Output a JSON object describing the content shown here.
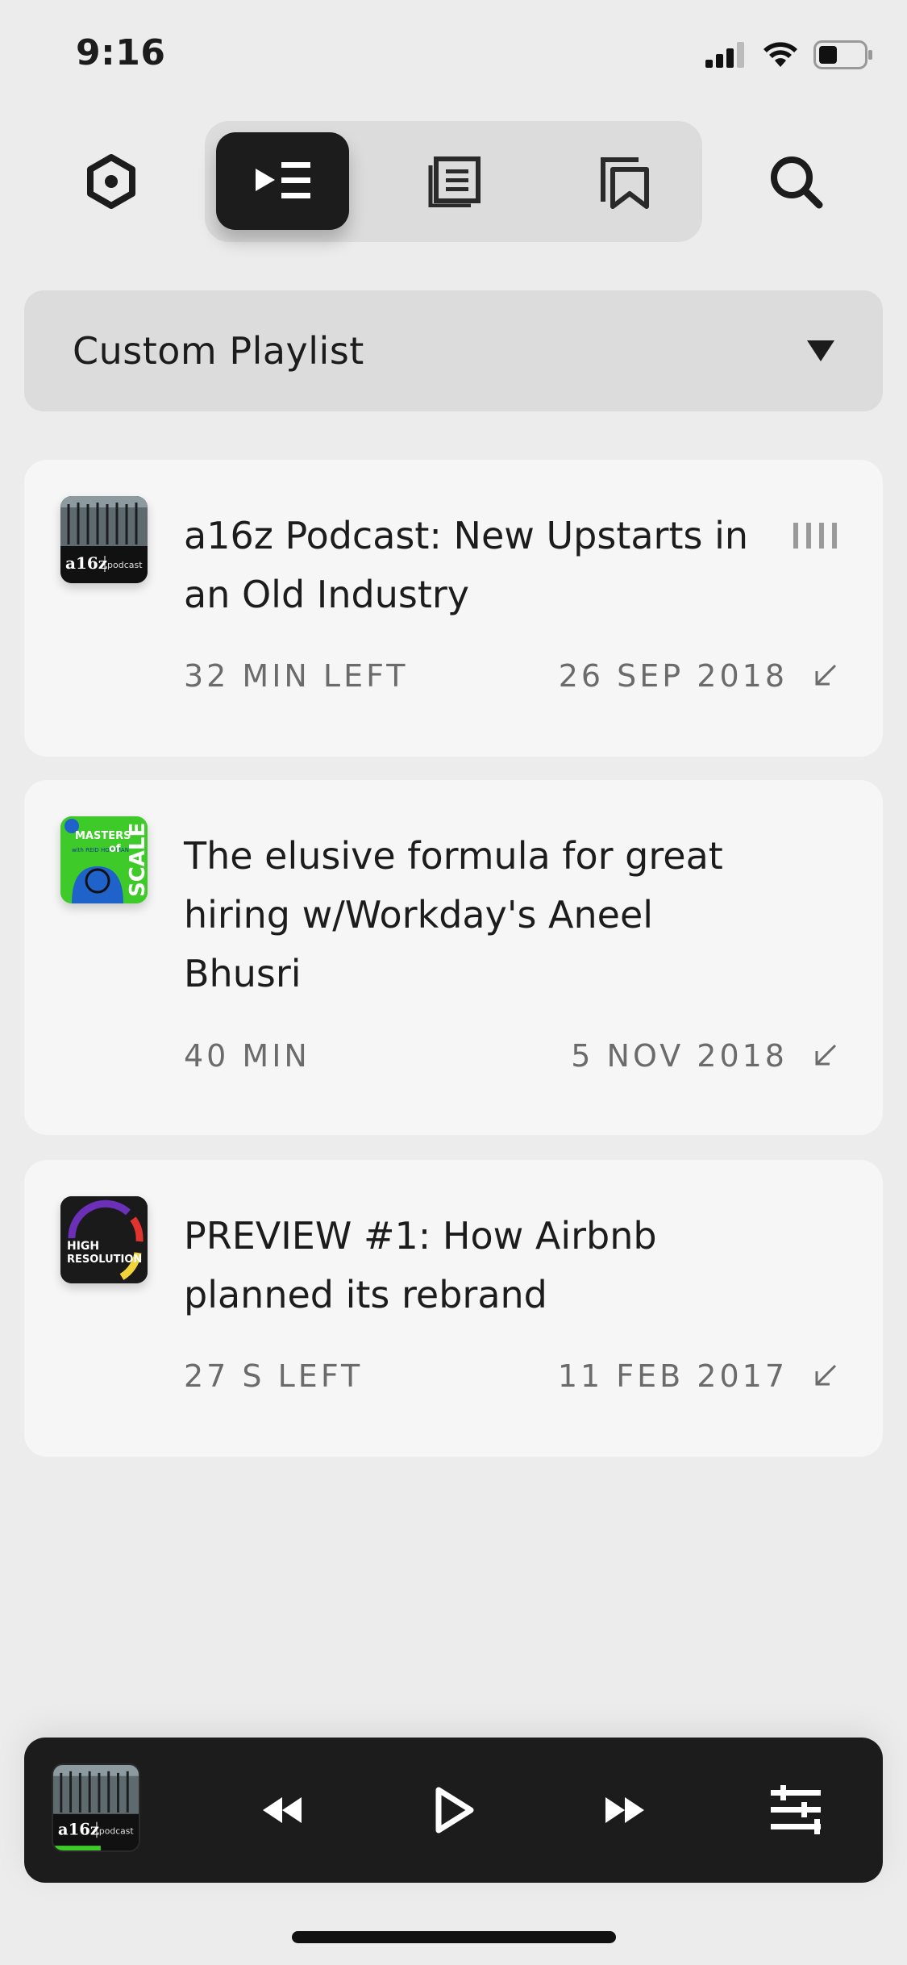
{
  "status": {
    "time": "9:16"
  },
  "toolbar": {
    "settings_icon": "hexagon-icon",
    "tabs": [
      {
        "icon": "up-next-queue-icon",
        "active": true
      },
      {
        "icon": "notes-list-icon",
        "active": false
      },
      {
        "icon": "bookmarks-icon",
        "active": false
      }
    ],
    "search_icon": "search-icon"
  },
  "dropdown": {
    "label": "Custom Playlist"
  },
  "episodes": [
    {
      "podcast": "a16z Podcast",
      "title": "a16z Podcast: New Upstarts in an Old Industry",
      "remaining": "32 MIN LEFT",
      "date": "26 SEP 2018",
      "in_progress": true
    },
    {
      "podcast": "Masters of Scale",
      "title": "The elusive formula for great hiring w/Workday's Aneel Bhusri",
      "remaining": "40 MIN",
      "date": "5 NOV 2018",
      "in_progress": false
    },
    {
      "podcast": "High Resolution",
      "title": "PREVIEW #1: How Airbnb planned its rebrand",
      "remaining": "27 S LEFT",
      "date": "11 FEB 2017",
      "in_progress": false
    }
  ],
  "player": {
    "now_playing_art": "a16z podcast",
    "controls": [
      "rewind-icon",
      "play-icon",
      "fast-forward-icon",
      "playlist-settings-icon"
    ]
  },
  "art": {
    "a16z_text": "a16z",
    "a16z_sub": "podcast",
    "mos_line1": "MASTERS",
    "mos_with": "with REID HOFFMAN",
    "mos_of": "of",
    "mos_scale": "SCALE",
    "hr_line1": "HIGH",
    "hr_line2": "RESOLUTION"
  },
  "colors": {
    "background": "#ececec",
    "card": "#f6f6f6",
    "dark": "#1c1c1c",
    "meta": "#6b6b6b"
  }
}
